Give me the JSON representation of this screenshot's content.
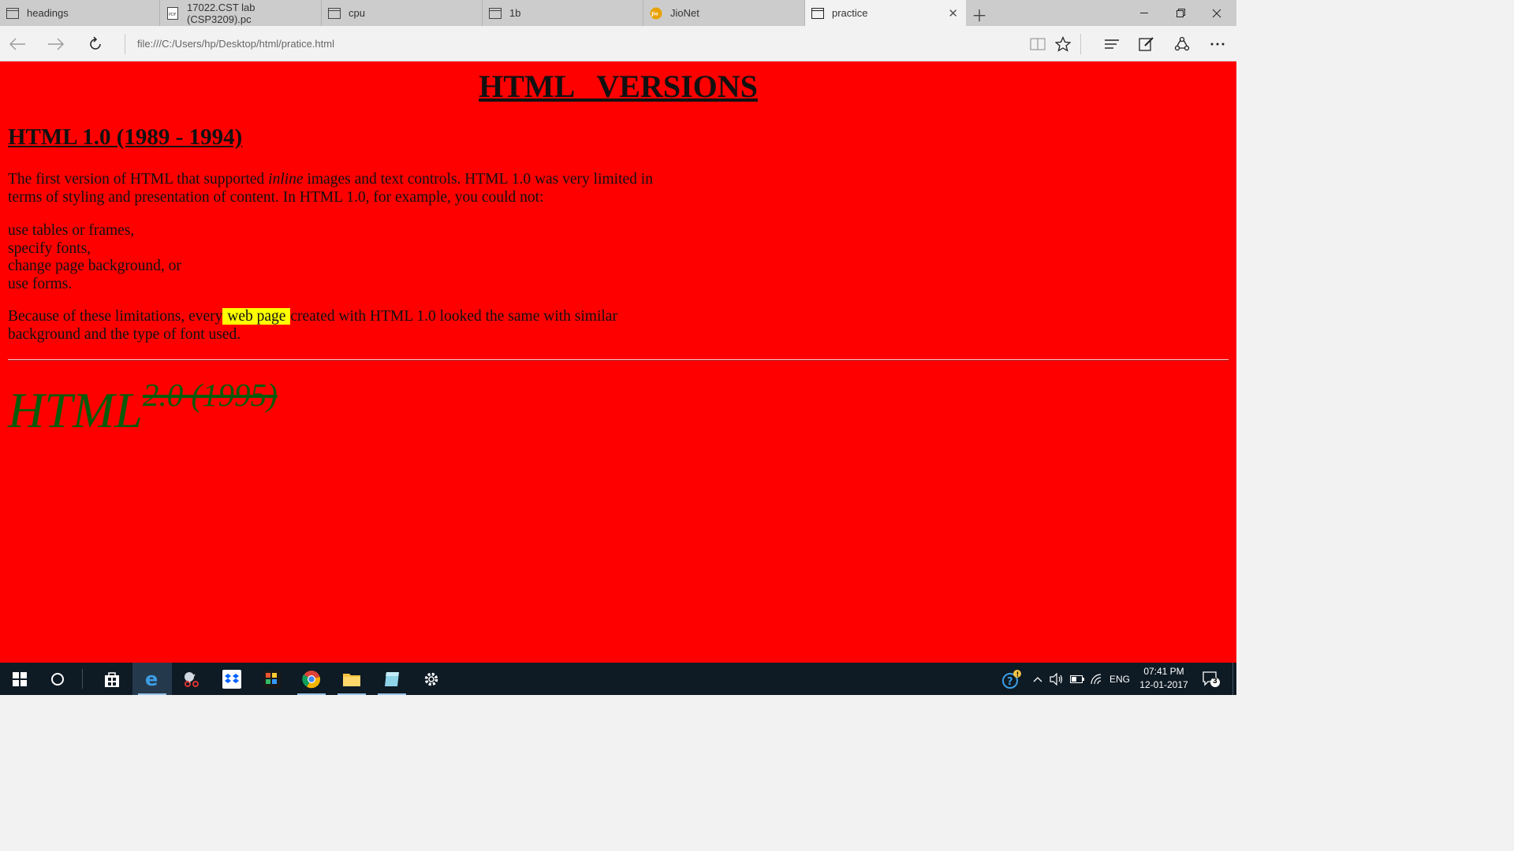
{
  "tabs": [
    {
      "label": "headings",
      "icon": "page-icon"
    },
    {
      "label": "17022.CST lab (CSP3209).pc",
      "icon": "pdf-icon"
    },
    {
      "label": "cpu",
      "icon": "page-icon"
    },
    {
      "label": "1b",
      "icon": "page-icon"
    },
    {
      "label": "JioNet",
      "icon": "jio-icon",
      "icon_text": "Jio"
    },
    {
      "label": "practice",
      "icon": "page-icon",
      "active": true
    }
  ],
  "address": {
    "url": "file:///C:/Users/hp/Desktop/html/pratice.html"
  },
  "page": {
    "title": "HTML   VERSIONS",
    "heading1": "HTML 1.0 (1989 - 1994)",
    "para1_a": "The first version of HTML that supported ",
    "para1_em": "inline",
    "para1_b": " images and text controls. HTML 1.0 was very limited in terms of styling and presentation of content. In HTML 1.0, for example, you could not:",
    "list": [
      "use tables or frames,",
      "specify fonts,",
      "change page background, or",
      "use forms."
    ],
    "para2_a": "Because of these limitations, every",
    "para2_highlight": " web page ",
    "para2_b": "created with HTML 1.0 looked the same with similar background and the type of font used.",
    "big_text": "HTML",
    "struck_text": "2.0 (1995)"
  },
  "taskbar": {
    "lang": "ENG",
    "time": "07:41 PM",
    "date": "12-01-2017",
    "notifications": "3"
  },
  "colors": {
    "page_bg": "#ff0000",
    "highlight": "#ffff00",
    "green_text": "#0b5a0b",
    "taskbar_bg": "#0e1a24"
  }
}
